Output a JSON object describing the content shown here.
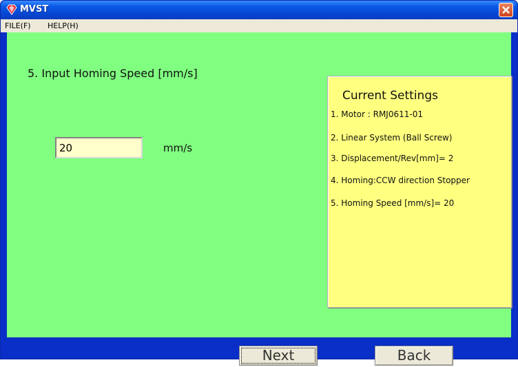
{
  "window": {
    "title": "MVST"
  },
  "menu": {
    "items": [
      {
        "label": "FILE(F)"
      },
      {
        "label": "HELP(H)"
      }
    ]
  },
  "main": {
    "heading": "5. Input Homing Speed [mm/s]",
    "speed_value": "20",
    "unit": "mm/s"
  },
  "settings": {
    "title": "Current Settings",
    "lines": [
      "1. Motor : RMJ0611-01",
      "2. Linear System (Ball Screw)",
      "3. Displacement/Rev[mm]= 2",
      "4. Homing:CCW direction Stopper",
      "5. Homing Speed [mm/s]= 20"
    ]
  },
  "buttons": {
    "next": "Next",
    "back": "Back"
  },
  "colors": {
    "client_background": "#80ff80",
    "panel_background": "#ffff80",
    "input_background": "#ffffcc",
    "window_frame": "#0a2ec8"
  },
  "icons": {
    "app": "gem-icon",
    "close": "close-icon"
  }
}
